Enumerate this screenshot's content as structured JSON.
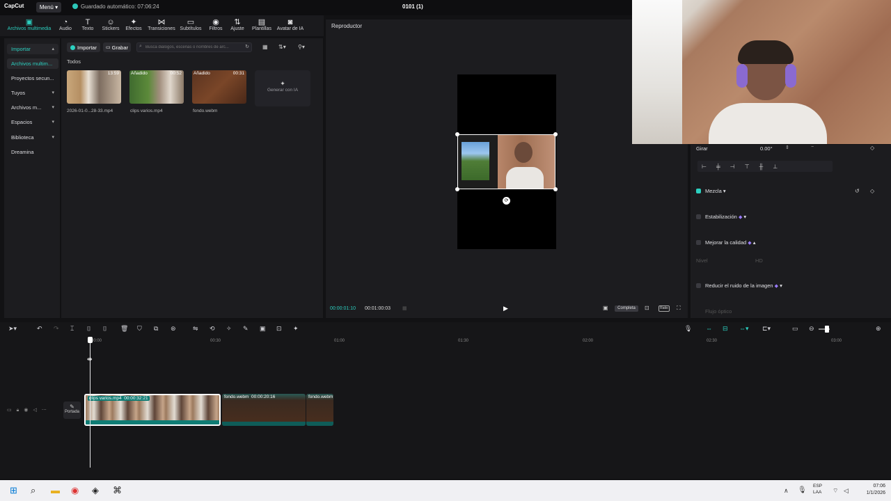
{
  "app": {
    "logo": "CapCut",
    "menu_label": "Menú",
    "autosave": "Guardado automático: 07:06:24",
    "project_title": "0101 (1)"
  },
  "toolbar": [
    {
      "icon": "media-icon",
      "glyph": "▣",
      "label": "Archivos multimedia"
    },
    {
      "icon": "audio-icon",
      "glyph": "◔",
      "label": "Audio"
    },
    {
      "icon": "text-icon",
      "glyph": "T",
      "label": "Texto"
    },
    {
      "icon": "sticker-icon",
      "glyph": "☺",
      "label": "Stickers"
    },
    {
      "icon": "effects-icon",
      "glyph": "✦",
      "label": "Efectos"
    },
    {
      "icon": "transition-icon",
      "glyph": "⋈",
      "label": "Transiciones"
    },
    {
      "icon": "subtitles-icon",
      "glyph": "▭",
      "label": "Subtítulos"
    },
    {
      "icon": "filters-icon",
      "glyph": "◉",
      "label": "Filtros"
    },
    {
      "icon": "adjust-icon",
      "glyph": "⇅",
      "label": "Ajuste"
    },
    {
      "icon": "templates-icon",
      "glyph": "▤",
      "label": "Plantillas"
    },
    {
      "icon": "avatar-icon",
      "glyph": "◙",
      "label": "Avatar de IA"
    }
  ],
  "leftnav": [
    {
      "label": "Importar",
      "chev": "▴"
    },
    {
      "label": "Archivos multim...",
      "chev": ""
    },
    {
      "label": "Proyectos secun...",
      "chev": ""
    },
    {
      "label": "Tuyos",
      "chev": "▾"
    },
    {
      "label": "Archivos m...",
      "chev": "▾"
    },
    {
      "label": "Espacios",
      "chev": "▾"
    },
    {
      "label": "Biblioteca",
      "chev": "▾"
    },
    {
      "label": "Dreamina",
      "chev": ""
    }
  ],
  "media": {
    "import_label": "Importar",
    "record_label": "Grabar",
    "search_placeholder": "Busca diálogos, escenas o nombres de arc...",
    "section": "Todos",
    "items": [
      {
        "tag": "",
        "duration": "13:59",
        "name": "2026-01-0...28-33.mp4"
      },
      {
        "tag": "Añadido",
        "duration": "00:52",
        "name": "clips varios.mp4"
      },
      {
        "tag": "Añadido",
        "duration": "00:31",
        "name": "fondo.webm"
      }
    ],
    "gen_ai_label": "Generar con IA"
  },
  "player": {
    "title": "Reproductor",
    "current_time": "00:00:01:10",
    "total_time": "00:01:00:03",
    "completa_label": "Completa",
    "ratio_label": "Ratio"
  },
  "rightpanel": {
    "girar_label": "Girar",
    "girar_value": "0.00°",
    "mezcla_label": "Mezcla",
    "estabilizacion_label": "Estabilización",
    "mejorar_label": "Mejorar la calidad",
    "nivel_label": "Nivel",
    "nivel_value": "HD",
    "ruido_label": "Reducir el ruido de la imagen",
    "flujo_label": "Flujo óptico"
  },
  "timeline": {
    "ticks": [
      "00:00",
      "00:30",
      "01:00",
      "01:30",
      "02:00",
      "02:30",
      "03:00"
    ],
    "cover_label": "Portada",
    "clips": [
      {
        "name": "clips varios.mp4",
        "duration": "00:00:32:21"
      },
      {
        "name": "fondo.webm",
        "duration": "00:00:20:16"
      },
      {
        "name": "fondo.webm",
        "duration": ""
      }
    ]
  },
  "taskbar": {
    "lang": "ESP",
    "lang2": "LAA",
    "time": "07:06",
    "date": "1/1/2026"
  },
  "colors": {
    "accent": "#2cd0c0",
    "background": "#121214",
    "panel": "#1c1c1f"
  }
}
